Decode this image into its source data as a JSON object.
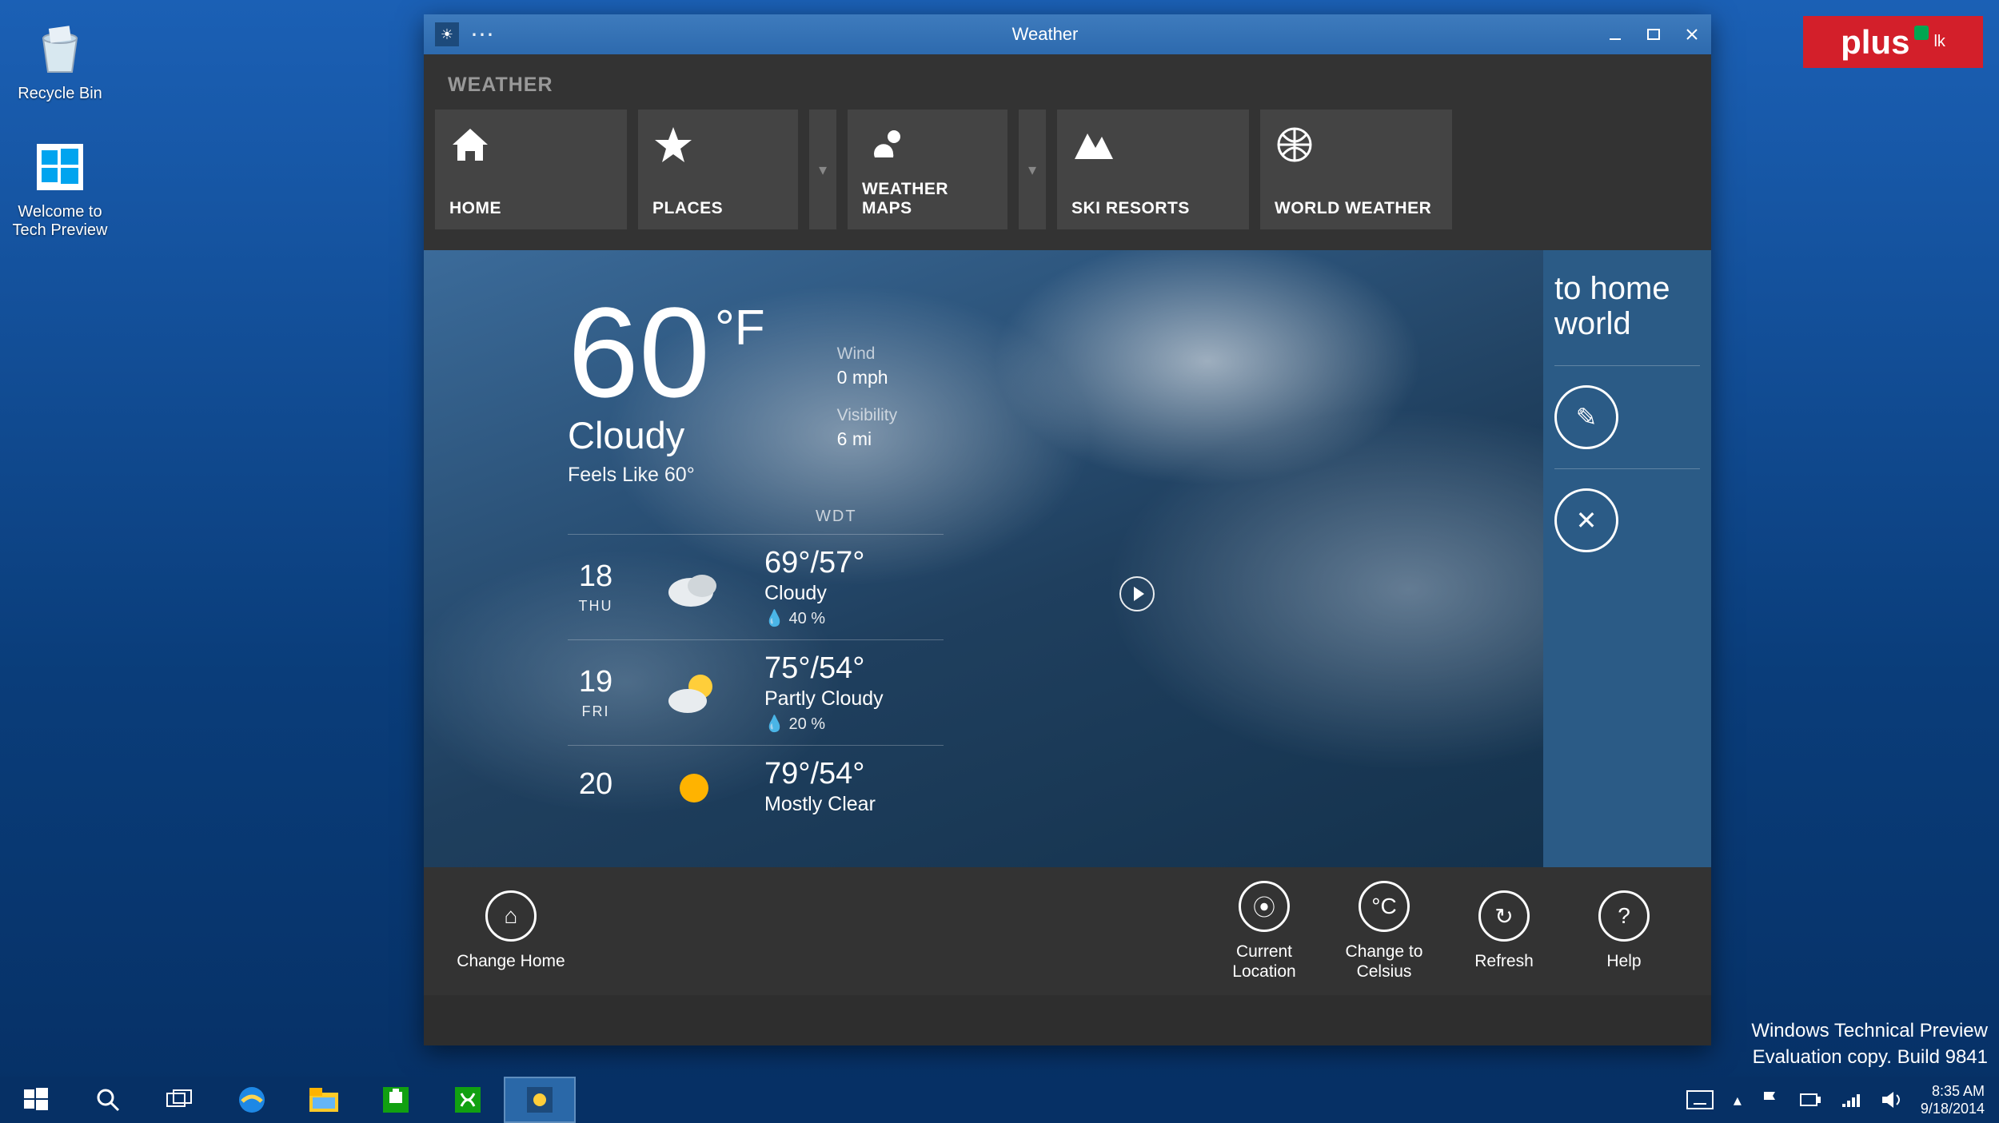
{
  "desktop": {
    "recycle": "Recycle Bin",
    "welcome": "Welcome to\nTech Preview"
  },
  "brand": {
    "text": "plus",
    "suffix": "lk"
  },
  "watermark": {
    "line1": "Windows Technical Preview",
    "line2": "Evaluation copy. Build 9841"
  },
  "taskbar": {
    "time": "8:35 AM",
    "date": "9/18/2014"
  },
  "window": {
    "title": "Weather",
    "nav_title": "WEATHER",
    "nav": [
      {
        "label": "HOME"
      },
      {
        "label": "PLACES"
      },
      {
        "label": "WEATHER MAPS"
      },
      {
        "label": "SKI RESORTS"
      },
      {
        "label": "WORLD WEATHER"
      }
    ],
    "current": {
      "temp": "60",
      "unit": "°F",
      "condition": "Cloudy",
      "feels": "Feels Like 60°",
      "wind_label": "Wind",
      "wind": "0 mph",
      "vis_label": "Visibility",
      "vis": "6 mi",
      "provider": "WDT"
    },
    "forecast": [
      {
        "date": "18",
        "day": "THU",
        "hi_lo": "69°/57°",
        "cond": "Cloudy",
        "precip": "40 %"
      },
      {
        "date": "19",
        "day": "FRI",
        "hi_lo": "75°/54°",
        "cond": "Partly Cloudy",
        "precip": "20 %"
      },
      {
        "date": "20",
        "day": "",
        "hi_lo": "79°/54°",
        "cond": "Mostly Clear",
        "precip": ""
      }
    ],
    "sidepane": {
      "heading": "to home world"
    },
    "appbar": [
      {
        "label": "Change Home"
      },
      {
        "label": "Current Location"
      },
      {
        "label": "Change to Celsius"
      },
      {
        "label": "Refresh"
      },
      {
        "label": "Help"
      }
    ]
  }
}
